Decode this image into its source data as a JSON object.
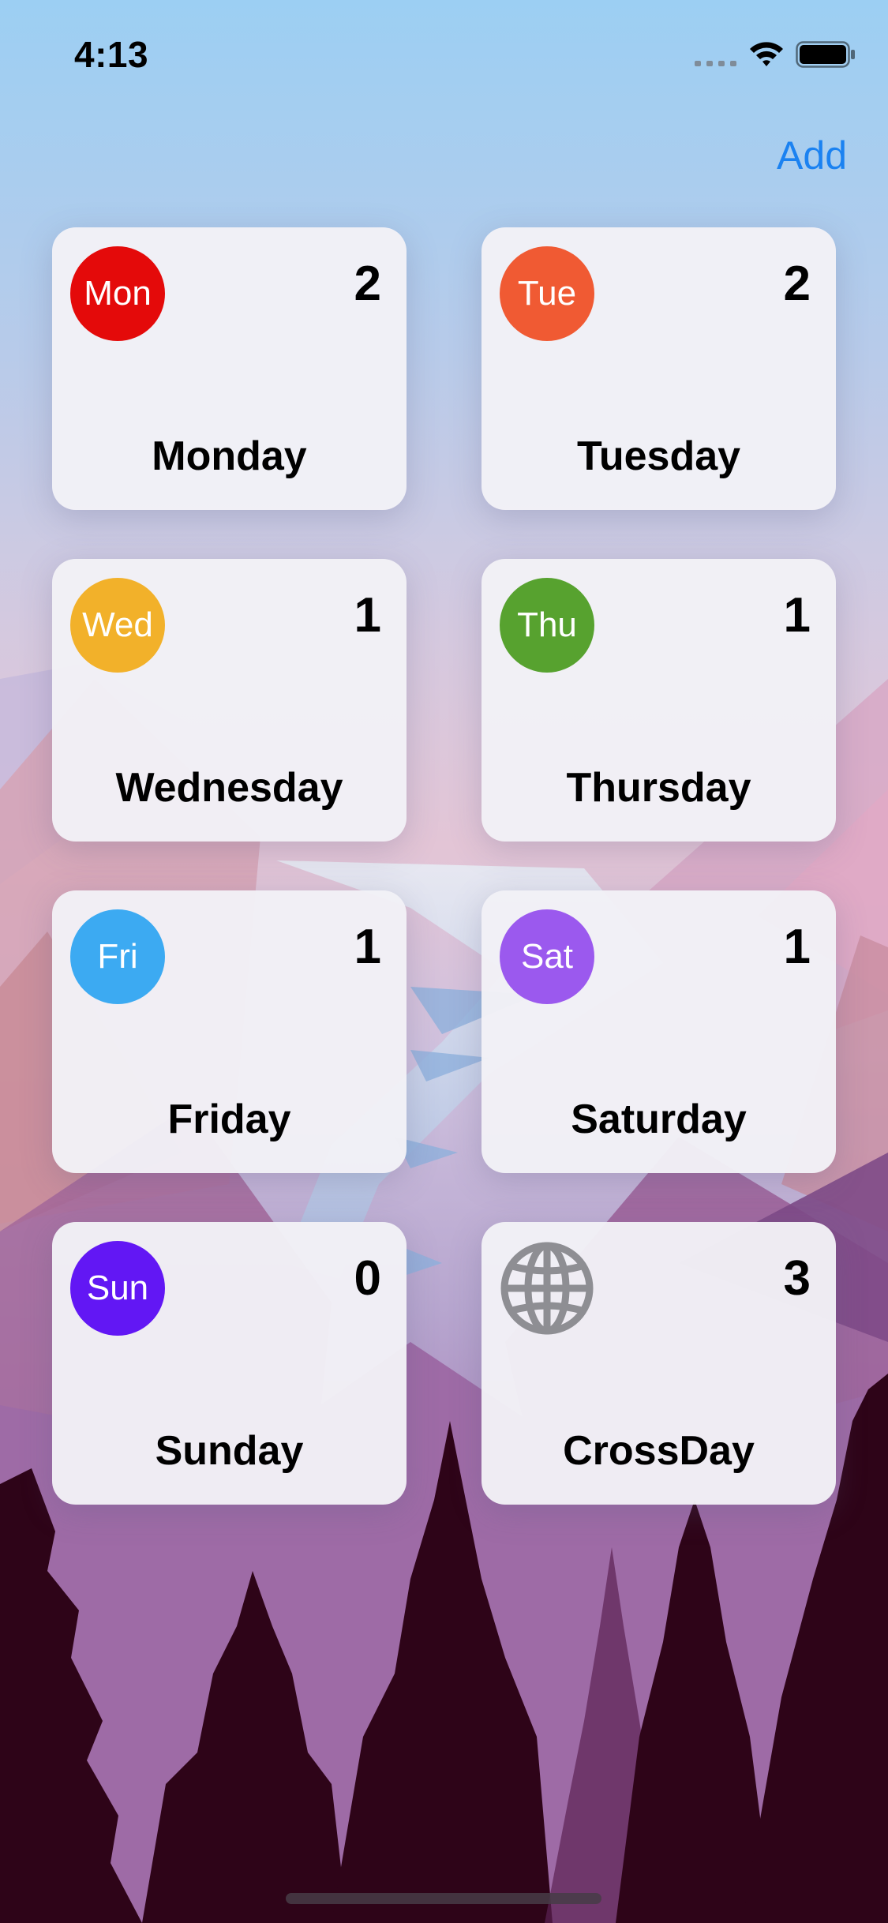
{
  "status_bar": {
    "time": "4:13"
  },
  "nav": {
    "add_label": "Add"
  },
  "days": [
    {
      "abbr": "Mon",
      "name": "Monday",
      "count": "2",
      "color": "#e40a0a"
    },
    {
      "abbr": "Tue",
      "name": "Tuesday",
      "count": "2",
      "color": "#f05a33"
    },
    {
      "abbr": "Wed",
      "name": "Wednesday",
      "count": "1",
      "color": "#f2b12a"
    },
    {
      "abbr": "Thu",
      "name": "Thursday",
      "count": "1",
      "color": "#57a22f"
    },
    {
      "abbr": "Fri",
      "name": "Friday",
      "count": "1",
      "color": "#3caaf2"
    },
    {
      "abbr": "Sat",
      "name": "Saturday",
      "count": "1",
      "color": "#9b59ee"
    },
    {
      "abbr": "Sun",
      "name": "Sunday",
      "count": "0",
      "color": "#6217f4"
    },
    {
      "icon": "globe-icon",
      "name": "CrossDay",
      "count": "3",
      "color": "#8e8e93"
    }
  ],
  "colors": {
    "accent": "#1b82f1",
    "card_background": "#f2f1f6"
  }
}
